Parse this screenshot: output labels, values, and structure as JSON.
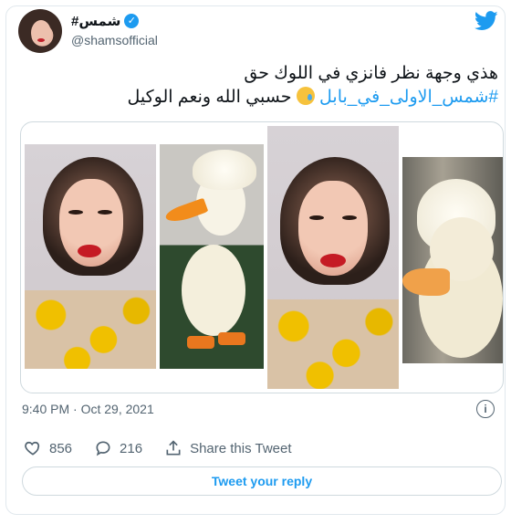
{
  "author": {
    "display_name": "#شمس",
    "handle": "@shamsofficial"
  },
  "tweet": {
    "line1": "هذي وجهة نظر فانزي في اللوك حق",
    "hashtag": "#شمس_الاولى_في_بابل",
    "line2_rest": "حسبي الله ونعم الوكيل",
    "emoji": "crying-face"
  },
  "meta": {
    "timestamp": "9:40 PM · Oct 29, 2021"
  },
  "actions": {
    "like_count": "856",
    "reply_count": "216",
    "share_label": "Share this Tweet"
  },
  "reply_button": {
    "label": "Tweet your reply"
  },
  "icons": {
    "bird": "twitter-bird-icon",
    "verified": "verified-badge-icon",
    "info": "info-icon",
    "like": "heart-icon",
    "reply": "reply-bubble-icon",
    "share": "share-icon"
  },
  "colors": {
    "accent": "#1d9bf0",
    "muted": "#536471",
    "border": "#cfd9de"
  }
}
